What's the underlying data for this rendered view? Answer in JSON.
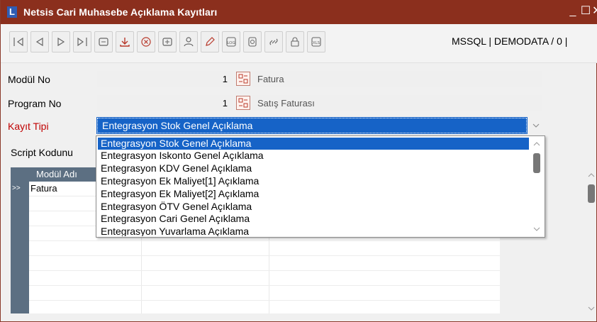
{
  "window": {
    "title": "Netsis Cari Muhasebe Açıklama Kayıtları",
    "logo_letter": "L",
    "minimize_glyph": "_",
    "maximize_glyph": "☐",
    "close_glyph": "✕"
  },
  "toolbar": {
    "buttons": [
      "first-record-icon",
      "prev-record-icon",
      "next-record-icon",
      "last-record-icon",
      "list-icon",
      "save-icon",
      "cancel-icon",
      "new-record-icon",
      "user-icon",
      "edit-icon",
      "log-icon",
      "info-icon",
      "link-icon",
      "lock-icon",
      "xls-icon"
    ],
    "connection_text": "MSSQL | DEMODATA / 0 |"
  },
  "form": {
    "modul_no": {
      "label": "Modül No",
      "value": "1",
      "description": "Fatura"
    },
    "program_no": {
      "label": "Program No",
      "value": "1",
      "description": "Satış Faturası"
    },
    "kayit_tipi": {
      "label": "Kayıt Tipi",
      "value": "Entegrasyon Stok Genel Açıklama",
      "label_color": "#c00000"
    }
  },
  "tabs": {
    "script_tab": "Script Kodunu"
  },
  "grid": {
    "header": "Modül Adı",
    "current_row_marker": ">>",
    "first_cell": "Fatura"
  },
  "dropdown": {
    "options": [
      "Entegrasyon Stok Genel Açıklama",
      "Entegrasyon Iskonto Genel Açıklama",
      "Entegrasyon KDV Genel Açıklama",
      "Entegrasyon Ek Maliyet[1] Açıklama",
      "Entegrasyon Ek Maliyet[2] Açıklama",
      "Entegrasyon ÖTV Genel  Açıklama",
      "Entegrasyon Cari Genel Açıklama",
      "Entegrasyon Yuvarlama Açıklama"
    ],
    "selected_index": 0
  },
  "colors": {
    "titlebar": "#8b2f1d",
    "selection": "#1663c7",
    "grid_header": "#5c6f82"
  }
}
